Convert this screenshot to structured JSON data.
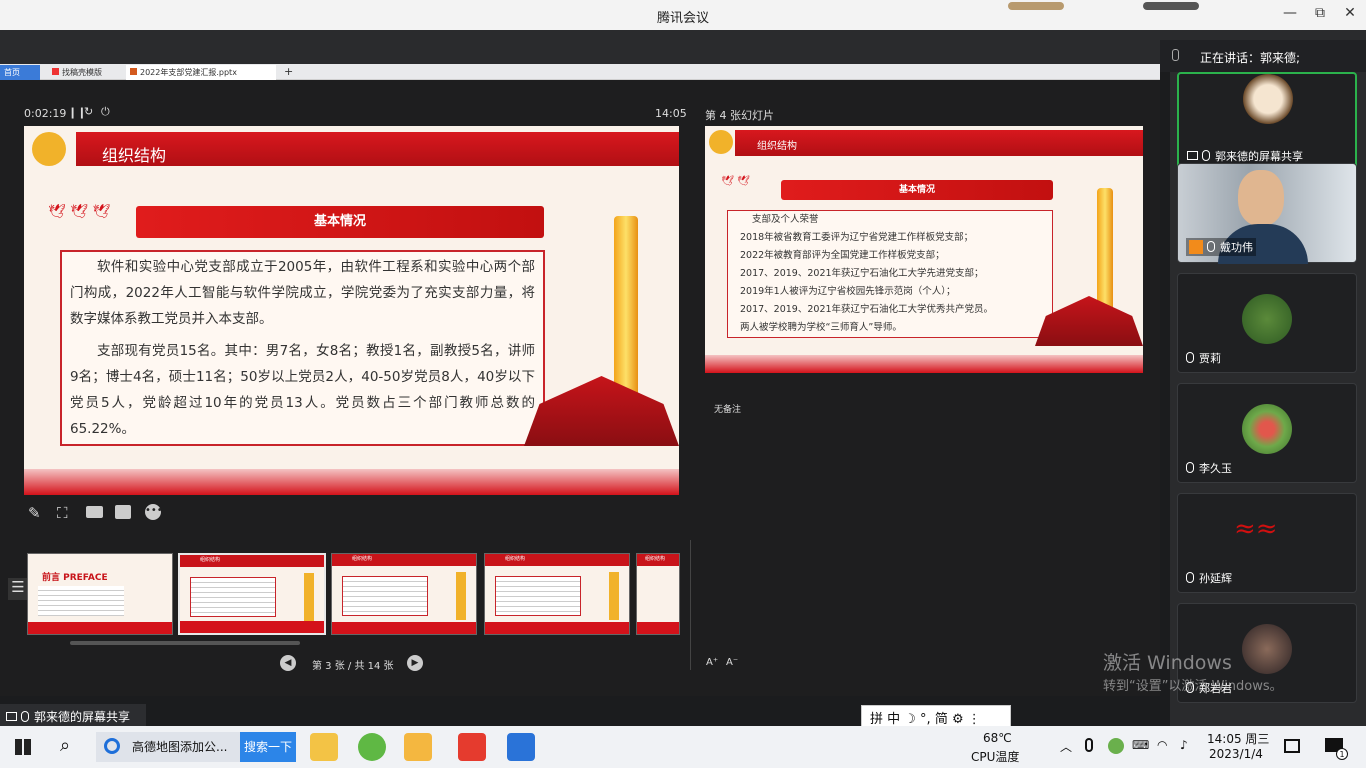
{
  "window": {
    "title": "腾讯会议",
    "minimize": "—",
    "restore": "⧉",
    "close": "✕"
  },
  "browser": {
    "tabs": [
      {
        "label": "首页"
      },
      {
        "label": "找稿壳模版"
      },
      {
        "label": "2022年支部党建汇报.pptx"
      }
    ],
    "new_tab": "+"
  },
  "presenter": {
    "timer": "0:02:19",
    "clock": "14:05",
    "next_slide_label": "第 4 张幻灯片",
    "notes": "无备注",
    "page_indicator": "第 3 张 / 共 14 张",
    "font_up": "A⁺",
    "font_down": "A⁻"
  },
  "slide_current": {
    "title": "组织结构",
    "subtitle": "基本情况",
    "para1": "软件和实验中心党支部成立于2005年，由软件工程系和实验中心两个部门构成，2022年人工智能与软件学院成立，学院党委为了充实支部力量，将数字媒体系教工党员并入本支部。",
    "para2": "支部现有党员15名。其中：男7名，女8名；教授1名，副教授5名，讲师9名；博士4名，硕士11名；50岁以上党员2人，40-50岁党员8人，40岁以下党员5人，党龄超过10年的党员13人。党员数占三个部门教师总数的65.22%。"
  },
  "slide_next": {
    "title": "组织结构",
    "subtitle": "基本情况",
    "lines": [
      "支部及个人荣誉",
      "2018年被省教育工委评为辽宁省党建工作样板党支部；",
      "2022年被教育部评为全国党建工作样板党支部；",
      "2017、2019、2021年获辽宁石油化工大学先进党支部；",
      "2019年1人被评为辽宁省校园先锋示范岗（个人）；",
      "2017、2019、2021年获辽宁石油化工大学优秀共产党员。",
      "两人被学校聘为学校“三师育人”导师。"
    ]
  },
  "thumbnails": [
    {
      "label": "前言 PREFACE"
    },
    {
      "label": "组织结构"
    },
    {
      "label": "组织结构"
    },
    {
      "label": "组织结构"
    },
    {
      "label": "组织结构"
    }
  ],
  "sidebar": {
    "speaking": "正在讲话：郭来德;",
    "participants": [
      {
        "name": "郭来德的屏幕共享"
      },
      {
        "name": "戴功伟"
      },
      {
        "name": "贾莉"
      },
      {
        "name": "李久玉"
      },
      {
        "name": "孙延辉"
      },
      {
        "name": "郑岩岩"
      }
    ]
  },
  "share_badge": "郭来德的屏幕共享",
  "watermark": {
    "line1": "激活 Windows",
    "line2": "转到“设置”以激活 Windows。"
  },
  "ime": {
    "text": "拼 中 ☽ °, 简 ⚙ ⋮"
  },
  "taskbar": {
    "browser_item": "高德地图添加公...",
    "search_btn": "搜索一下",
    "temp": "68℃",
    "temp_label": "CPU温度",
    "time": "14:05 周三",
    "date": "2023/1/4",
    "notification_count": "1"
  },
  "colors": {
    "accent_red": "#d4121a",
    "gold": "#f3a41a",
    "active_speaker_border": "#2bb24c"
  }
}
